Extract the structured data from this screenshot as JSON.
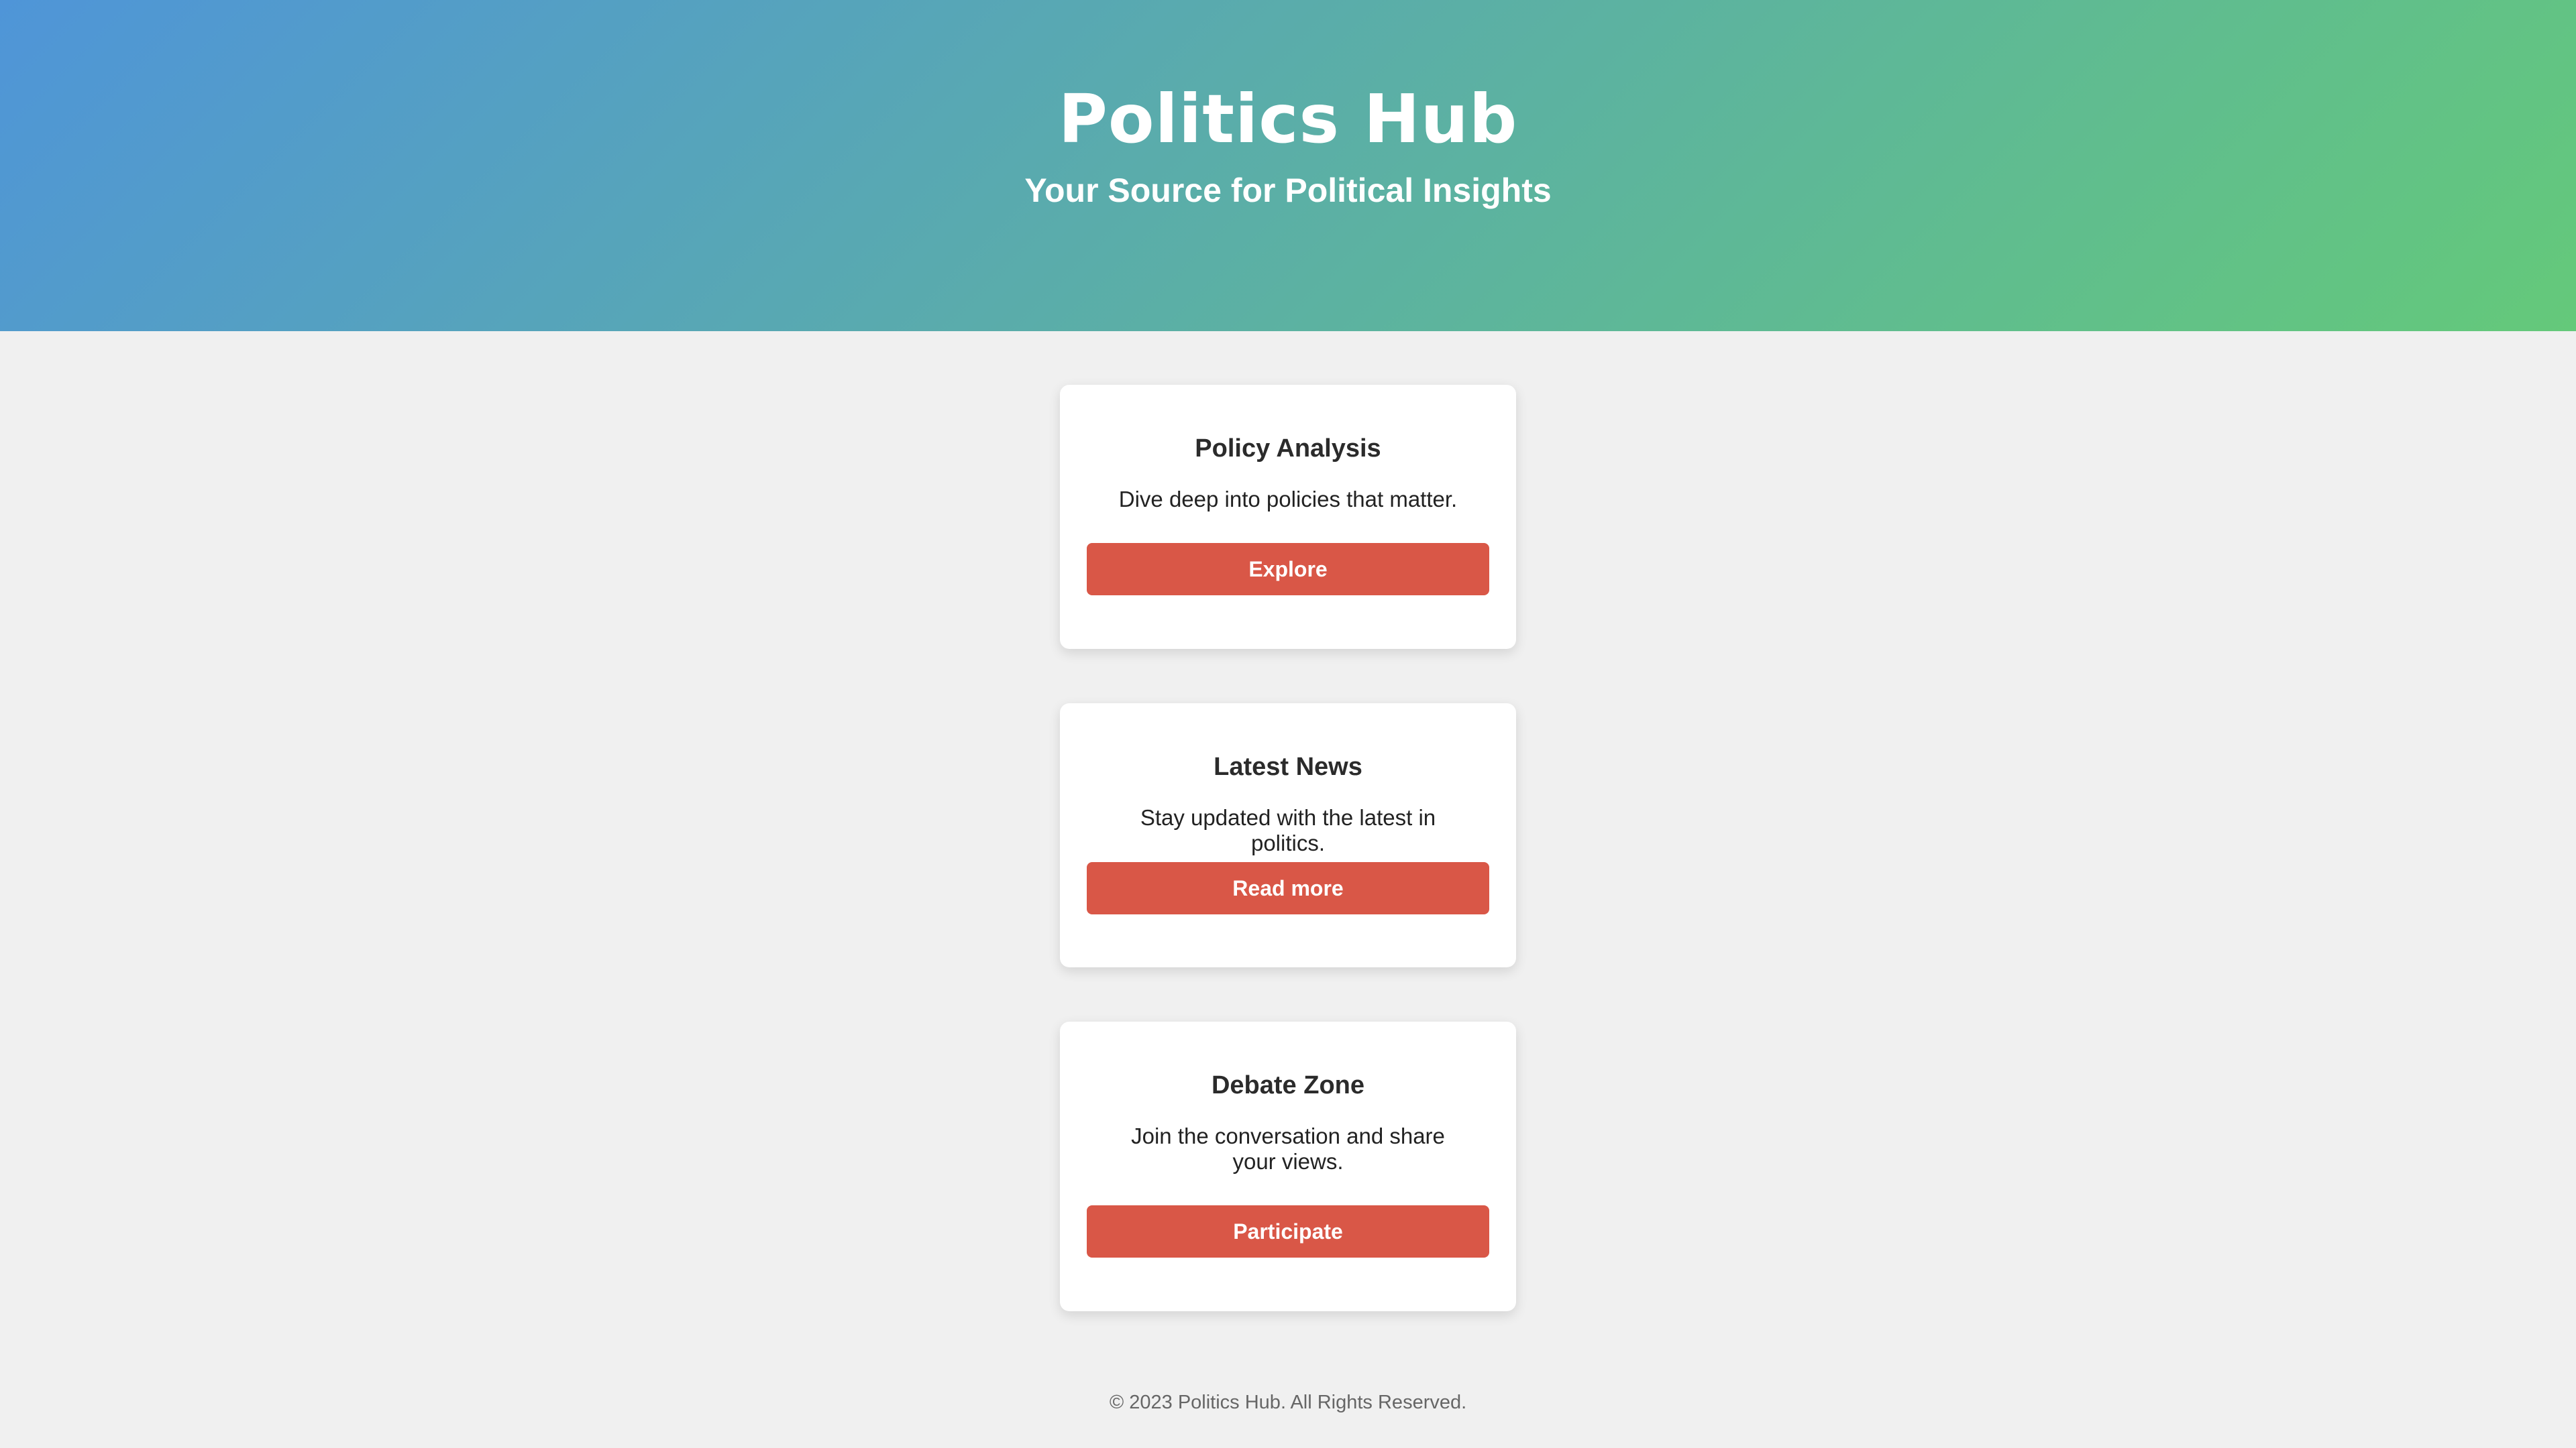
{
  "header": {
    "title": "Politics Hub",
    "tagline": "Your Source for Political Insights"
  },
  "cards": [
    {
      "title": "Policy Analysis",
      "text": "Dive deep into policies that matter.",
      "button": "Explore"
    },
    {
      "title": "Latest News",
      "text": "Stay updated with the latest in politics.",
      "button": "Read more"
    },
    {
      "title": "Debate Zone",
      "text": "Join the conversation and share your views.",
      "button": "Participate"
    }
  ],
  "footer": {
    "text": "© 2023 Politics Hub. All Rights Reserved."
  },
  "colors": {
    "header_gradient_start": "#4f95d8",
    "header_gradient_end": "#64c97a",
    "button": "#d95747",
    "background": "#f0f0f0"
  }
}
